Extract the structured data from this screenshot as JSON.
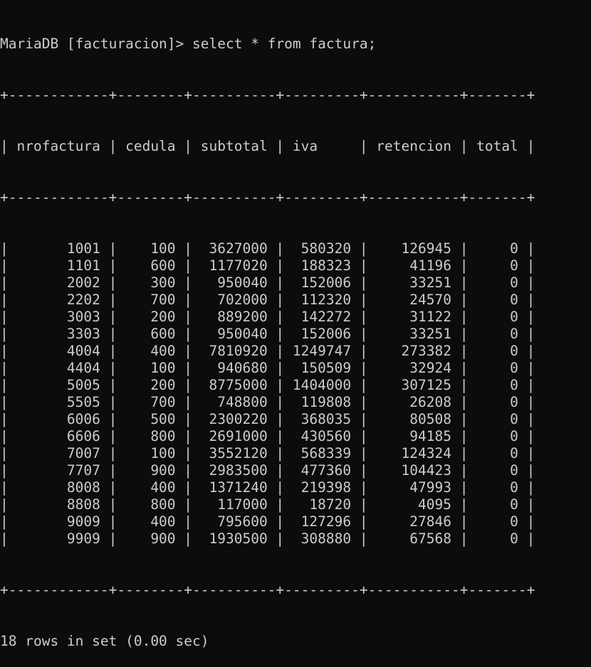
{
  "prompt": "MariaDB [facturacion]> ",
  "command": "select * from factura;",
  "separator": "+------------+--------+----------+---------+-----------+-------+",
  "header": "| nrofactura | cedula | subtotal | iva     | retencion | total |",
  "rows": [
    "|       1001 |    100 |  3627000 |  580320 |    126945 |     0 |",
    "|       1101 |    600 |  1177020 |  188323 |     41196 |     0 |",
    "|       2002 |    300 |   950040 |  152006 |     33251 |     0 |",
    "|       2202 |    700 |   702000 |  112320 |     24570 |     0 |",
    "|       3003 |    200 |   889200 |  142272 |     31122 |     0 |",
    "|       3303 |    600 |   950040 |  152006 |     33251 |     0 |",
    "|       4004 |    400 |  7810920 | 1249747 |    273382 |     0 |",
    "|       4404 |    100 |   940680 |  150509 |     32924 |     0 |",
    "|       5005 |    200 |  8775000 | 1404000 |    307125 |     0 |",
    "|       5505 |    700 |   748800 |  119808 |     26208 |     0 |",
    "|       6006 |    500 |  2300220 |  368035 |     80508 |     0 |",
    "|       6606 |    800 |  2691000 |  430560 |     94185 |     0 |",
    "|       7007 |    100 |  3552120 |  568339 |    124324 |     0 |",
    "|       7707 |    900 |  2983500 |  477360 |    104423 |     0 |",
    "|       8008 |    400 |  1371240 |  219398 |     47993 |     0 |",
    "|       8808 |    800 |   117000 |   18720 |      4095 |     0 |",
    "|       9009 |    400 |   795600 |  127296 |     27846 |     0 |",
    "|       9909 |    900 |  1930500 |  308880 |     67568 |     0 |"
  ],
  "result_summary": "18 rows in set (0.00 sec)",
  "colors": {
    "background": "#0c0c0c",
    "foreground": "#cccccc"
  }
}
